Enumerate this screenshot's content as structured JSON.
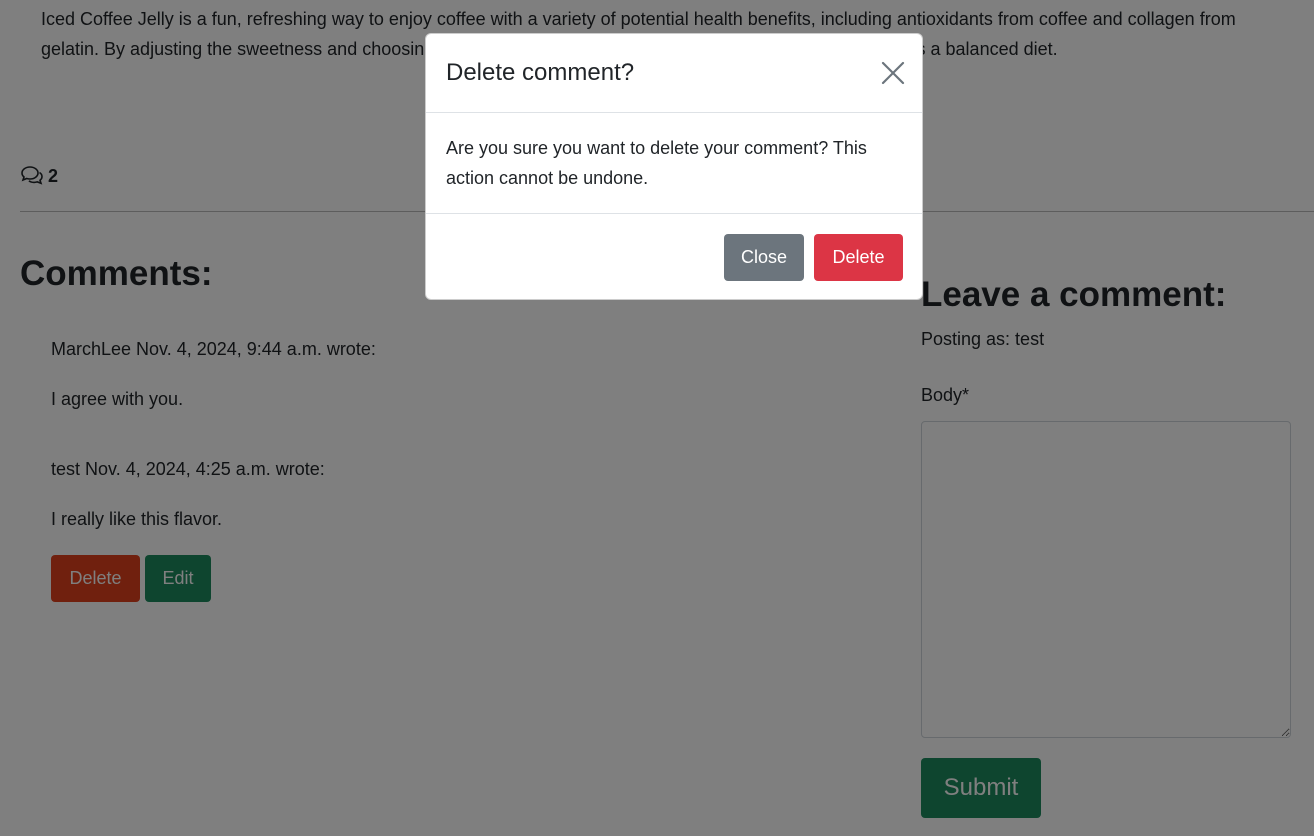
{
  "post": {
    "body": "Iced Coffee Jelly is a fun, refreshing way to enjoy coffee with a variety of potential health benefits, including antioxidants from coffee and collagen from gelatin. By adjusting the sweetness and choosing healthier ingredients, it can be a tasty treat that complements a balanced diet."
  },
  "comment_count": "2",
  "comments_section": {
    "heading": "Comments:",
    "items": [
      {
        "meta": "MarchLee Nov. 4, 2024, 9:44 a.m. wrote:",
        "text": "I agree with you."
      },
      {
        "meta": "test Nov. 4, 2024, 4:25 a.m. wrote:",
        "text": "I really like this flavor.",
        "delete_label": "Delete",
        "edit_label": "Edit"
      }
    ]
  },
  "comment_form": {
    "heading": "Leave a comment:",
    "posting_as": "Posting as: test",
    "body_label": "Body*",
    "submit_label": "Submit"
  },
  "modal": {
    "title": "Delete comment?",
    "body": "Are you sure you want to delete your comment? This action cannot be undone.",
    "close_label": "Close",
    "delete_label": "Delete"
  },
  "colors": {
    "overlay": "rgba(0,0,0,0.5)",
    "danger": "#dc3545",
    "secondary": "#6c757d",
    "success": "#1d8a5e",
    "orange": "#e0401c"
  }
}
